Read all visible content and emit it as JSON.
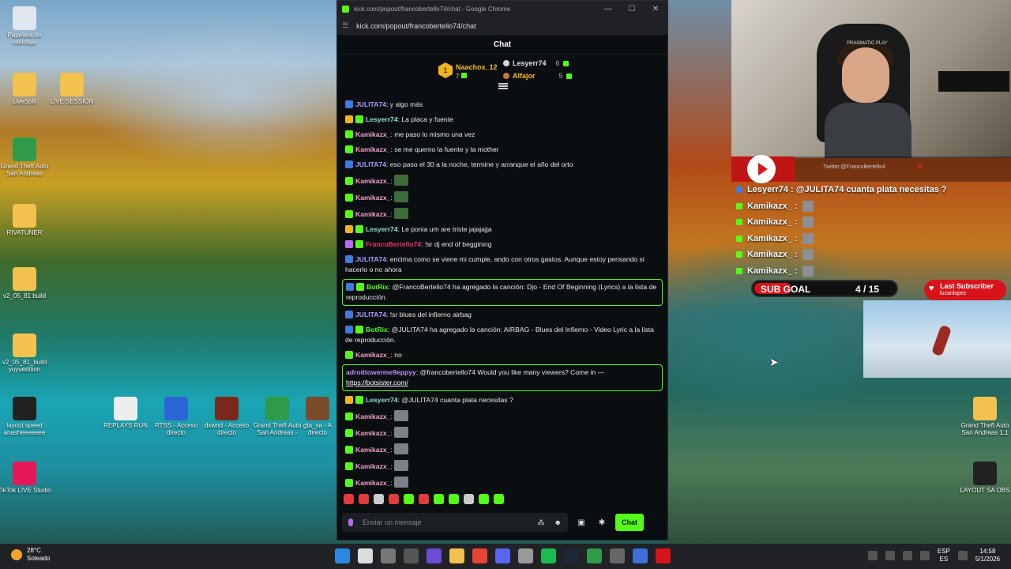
{
  "desktop": {
    "left_icons": [
      {
        "label": "Papelera de reciclaje",
        "color": "#dfe6ee"
      },
      {
        "label": "LiveSplit",
        "color": "#f2c14e"
      },
      {
        "label": "LIVE SESSION",
        "color": "#f2c14e"
      },
      {
        "label": "Grand Theft Auto San Andreas",
        "color": "#2f9a4a"
      },
      {
        "label": "RIVATUNER",
        "color": "#f2c14e"
      },
      {
        "label": "v2_05_81 build",
        "color": "#f2c14e"
      },
      {
        "label": "v2_05_81_build yuyuedition",
        "color": "#f2c14e"
      },
      {
        "label": "layout speed anasheeeeeee",
        "color": "#222222"
      },
      {
        "label": "TikTok LIVE Studio",
        "color": "#e6185a"
      }
    ],
    "mid_icons": [
      {
        "label": "REPLAYS RUN",
        "color": "#eeeeee"
      },
      {
        "label": "RTSS - Acceso directo",
        "color": "#2a66d6"
      },
      {
        "label": "dxwnd - Acceso directo",
        "color": "#7a2a1a"
      },
      {
        "label": "Grand Theft Auto San Andreas -",
        "color": "#2f9a4a"
      },
      {
        "label": "gta_sa - A directo",
        "color": "#7a4b2a"
      }
    ],
    "right_icons": [
      {
        "label": "Grand Theft Auto San Andreas 1.1",
        "color": "#f2c14e"
      },
      {
        "label": "LAYOUT SA OBS",
        "color": "#222222"
      }
    ]
  },
  "window": {
    "title": "kick.com/popout/francobertello74/chat - Google Chrome",
    "url": "kick.com/popout/francobertello74/chat",
    "controls": [
      "—",
      "☐",
      "✕"
    ]
  },
  "chat": {
    "header": "Chat",
    "leaderboard": {
      "first": {
        "rank": "1",
        "name": "Naachox_12",
        "count": "7"
      },
      "second": {
        "name": "Lesyerr74",
        "count": "6"
      },
      "third": {
        "name": "Alfajor",
        "count": "5"
      }
    },
    "messages": [
      {
        "user": "JULITA74",
        "color": "#a99bff",
        "badges": [
          "#3f7be0"
        ],
        "text": ": y algo más"
      },
      {
        "user": "Lesyerr74",
        "color": "#8ee0d0",
        "badges": [
          "#f2b41c",
          "#53fc18"
        ],
        "text": ": La placa y fuente"
      },
      {
        "user": "Kamikazx_",
        "color": "#f0a2c8",
        "badges": [
          "#53fc18"
        ],
        "text": ": me paso lo mismo una vez"
      },
      {
        "user": "Kamikazx_",
        "color": "#f0a2c8",
        "badges": [
          "#53fc18"
        ],
        "text": ": se me quemo la fuente y la mother"
      },
      {
        "user": "JULITA74",
        "color": "#a99bff",
        "badges": [
          "#3f7be0"
        ],
        "text": ": eso paso el 30 a la noche, termine y arranque el año del orto"
      },
      {
        "user": "Kamikazx_",
        "color": "#f0a2c8",
        "badges": [
          "#53fc18"
        ],
        "text": ":",
        "emote": "#3d6b3a"
      },
      {
        "user": "Kamikazx_",
        "color": "#f0a2c8",
        "badges": [
          "#53fc18"
        ],
        "text": ":",
        "emote": "#3d6b3a"
      },
      {
        "user": "Kamikazx_",
        "color": "#f0a2c8",
        "badges": [
          "#53fc18"
        ],
        "text": ":",
        "emote": "#3d6b3a"
      },
      {
        "user": "Lesyerr74",
        "color": "#8ee0d0",
        "badges": [
          "#f2b41c",
          "#53fc18"
        ],
        "text": ": Le ponia um are triste jajajajja"
      },
      {
        "user": "FrancoBertello74",
        "color": "#e8336a",
        "badges": [
          "#b46cf5",
          "#53fc18"
        ],
        "text": ": !sr dj end of beggining"
      },
      {
        "user": "JULITA74",
        "color": "#a99bff",
        "badges": [
          "#3f7be0"
        ],
        "text": ": encima como se viene mi cumple, ando con otros gastos. Aunque estoy pensando si hacerlo o no ahora"
      },
      {
        "user": "BotRix",
        "color": "#53fc18",
        "badges": [
          "#3f7be0",
          "#53fc18"
        ],
        "text": ": @FrancoBertello74 ha agregado la canción: Djo - End Of Beginning (Lyrics) a la lista de reproducción.",
        "highlight": true
      },
      {
        "user": "JULITA74",
        "color": "#a99bff",
        "badges": [
          "#3f7be0"
        ],
        "text": ": !sr blues del infierno airbag"
      },
      {
        "user": "BotRix",
        "color": "#53fc18",
        "badges": [
          "#3f7be0",
          "#53fc18"
        ],
        "text": ": @JULITA74 ha agregado la canción: AIRBAG - Blues del Infierno - Video Lyric a la lista de reproducción."
      },
      {
        "user": "Kamikazx_",
        "color": "#f0a2c8",
        "badges": [
          "#53fc18"
        ],
        "text": ": no"
      },
      {
        "user": "adroittowerme9eppyy",
        "color": "#c58cff",
        "badges": [],
        "text": ": @francobertello74 Would you like many viewers? Come in —",
        "link": "https://botsister.com/",
        "highlight": true
      },
      {
        "user": "Lesyerr74",
        "color": "#8ee0d0",
        "badges": [
          "#f2b41c",
          "#53fc18"
        ],
        "text": ": @JULITA74 cuanta plata necesitas ?"
      },
      {
        "user": "Kamikazx_",
        "color": "#f0a2c8",
        "badges": [
          "#53fc18"
        ],
        "text": ":",
        "emote": "#7d8089"
      },
      {
        "user": "Kamikazx_",
        "color": "#f0a2c8",
        "badges": [
          "#53fc18"
        ],
        "text": ":",
        "emote": "#7d8089"
      },
      {
        "user": "Kamikazx_",
        "color": "#f0a2c8",
        "badges": [
          "#53fc18"
        ],
        "text": ":",
        "emote": "#7d8089"
      },
      {
        "user": "Kamikazx_",
        "color": "#f0a2c8",
        "badges": [
          "#53fc18"
        ],
        "text": ":",
        "emote": "#7d8089"
      },
      {
        "user": "Kamikazx_",
        "color": "#f0a2c8",
        "badges": [
          "#53fc18"
        ],
        "text": ":",
        "emote": "#7d8089"
      }
    ],
    "emote_bar": [
      "#e23b3b",
      "#e23b3b",
      "#cccccc",
      "#e23b3b",
      "#53fc18",
      "#e23b3b",
      "#53fc18",
      "#53fc18",
      "#cccccc",
      "#53fc18",
      "#53fc18"
    ],
    "input_placeholder": "Enviar un mensaje",
    "send_label": "Chat"
  },
  "stream_overlay": {
    "twitter": "Twitter:@FrancoBertello4",
    "cam_brand": "PRAGMATIC PLAY",
    "top_message": "Lesyerr74 : @JULITA74 cuanta plata necesitas ?",
    "kamikaze_lines": [
      "Kamikazx_ :",
      "Kamikazx_ :",
      "Kamikazx_ :",
      "Kamikazx_ :",
      "Kamikazx_ :"
    ],
    "sub_goal": {
      "label": "SUB GOAL",
      "current": 4,
      "target": 15,
      "text": "4 / 15"
    },
    "last_subscriber": {
      "title": "Last Subscriber",
      "name": "lucanlopez"
    }
  },
  "taskbar": {
    "weather_temp": "28°C",
    "weather_desc": "Soleado",
    "apps": [
      "#2b88e0",
      "#dddddd",
      "#777777",
      "#555555",
      "#6b4bd8",
      "#f2c14e",
      "#ea4335",
      "#5865f2",
      "#999999",
      "#1db954",
      "#1b2838",
      "#2f9a4a",
      "#666666",
      "#3f6fd8",
      "#d8141a"
    ],
    "lang_top": "ESP",
    "lang_bottom": "ES",
    "time": "14:58",
    "date": "5/1/2026"
  }
}
